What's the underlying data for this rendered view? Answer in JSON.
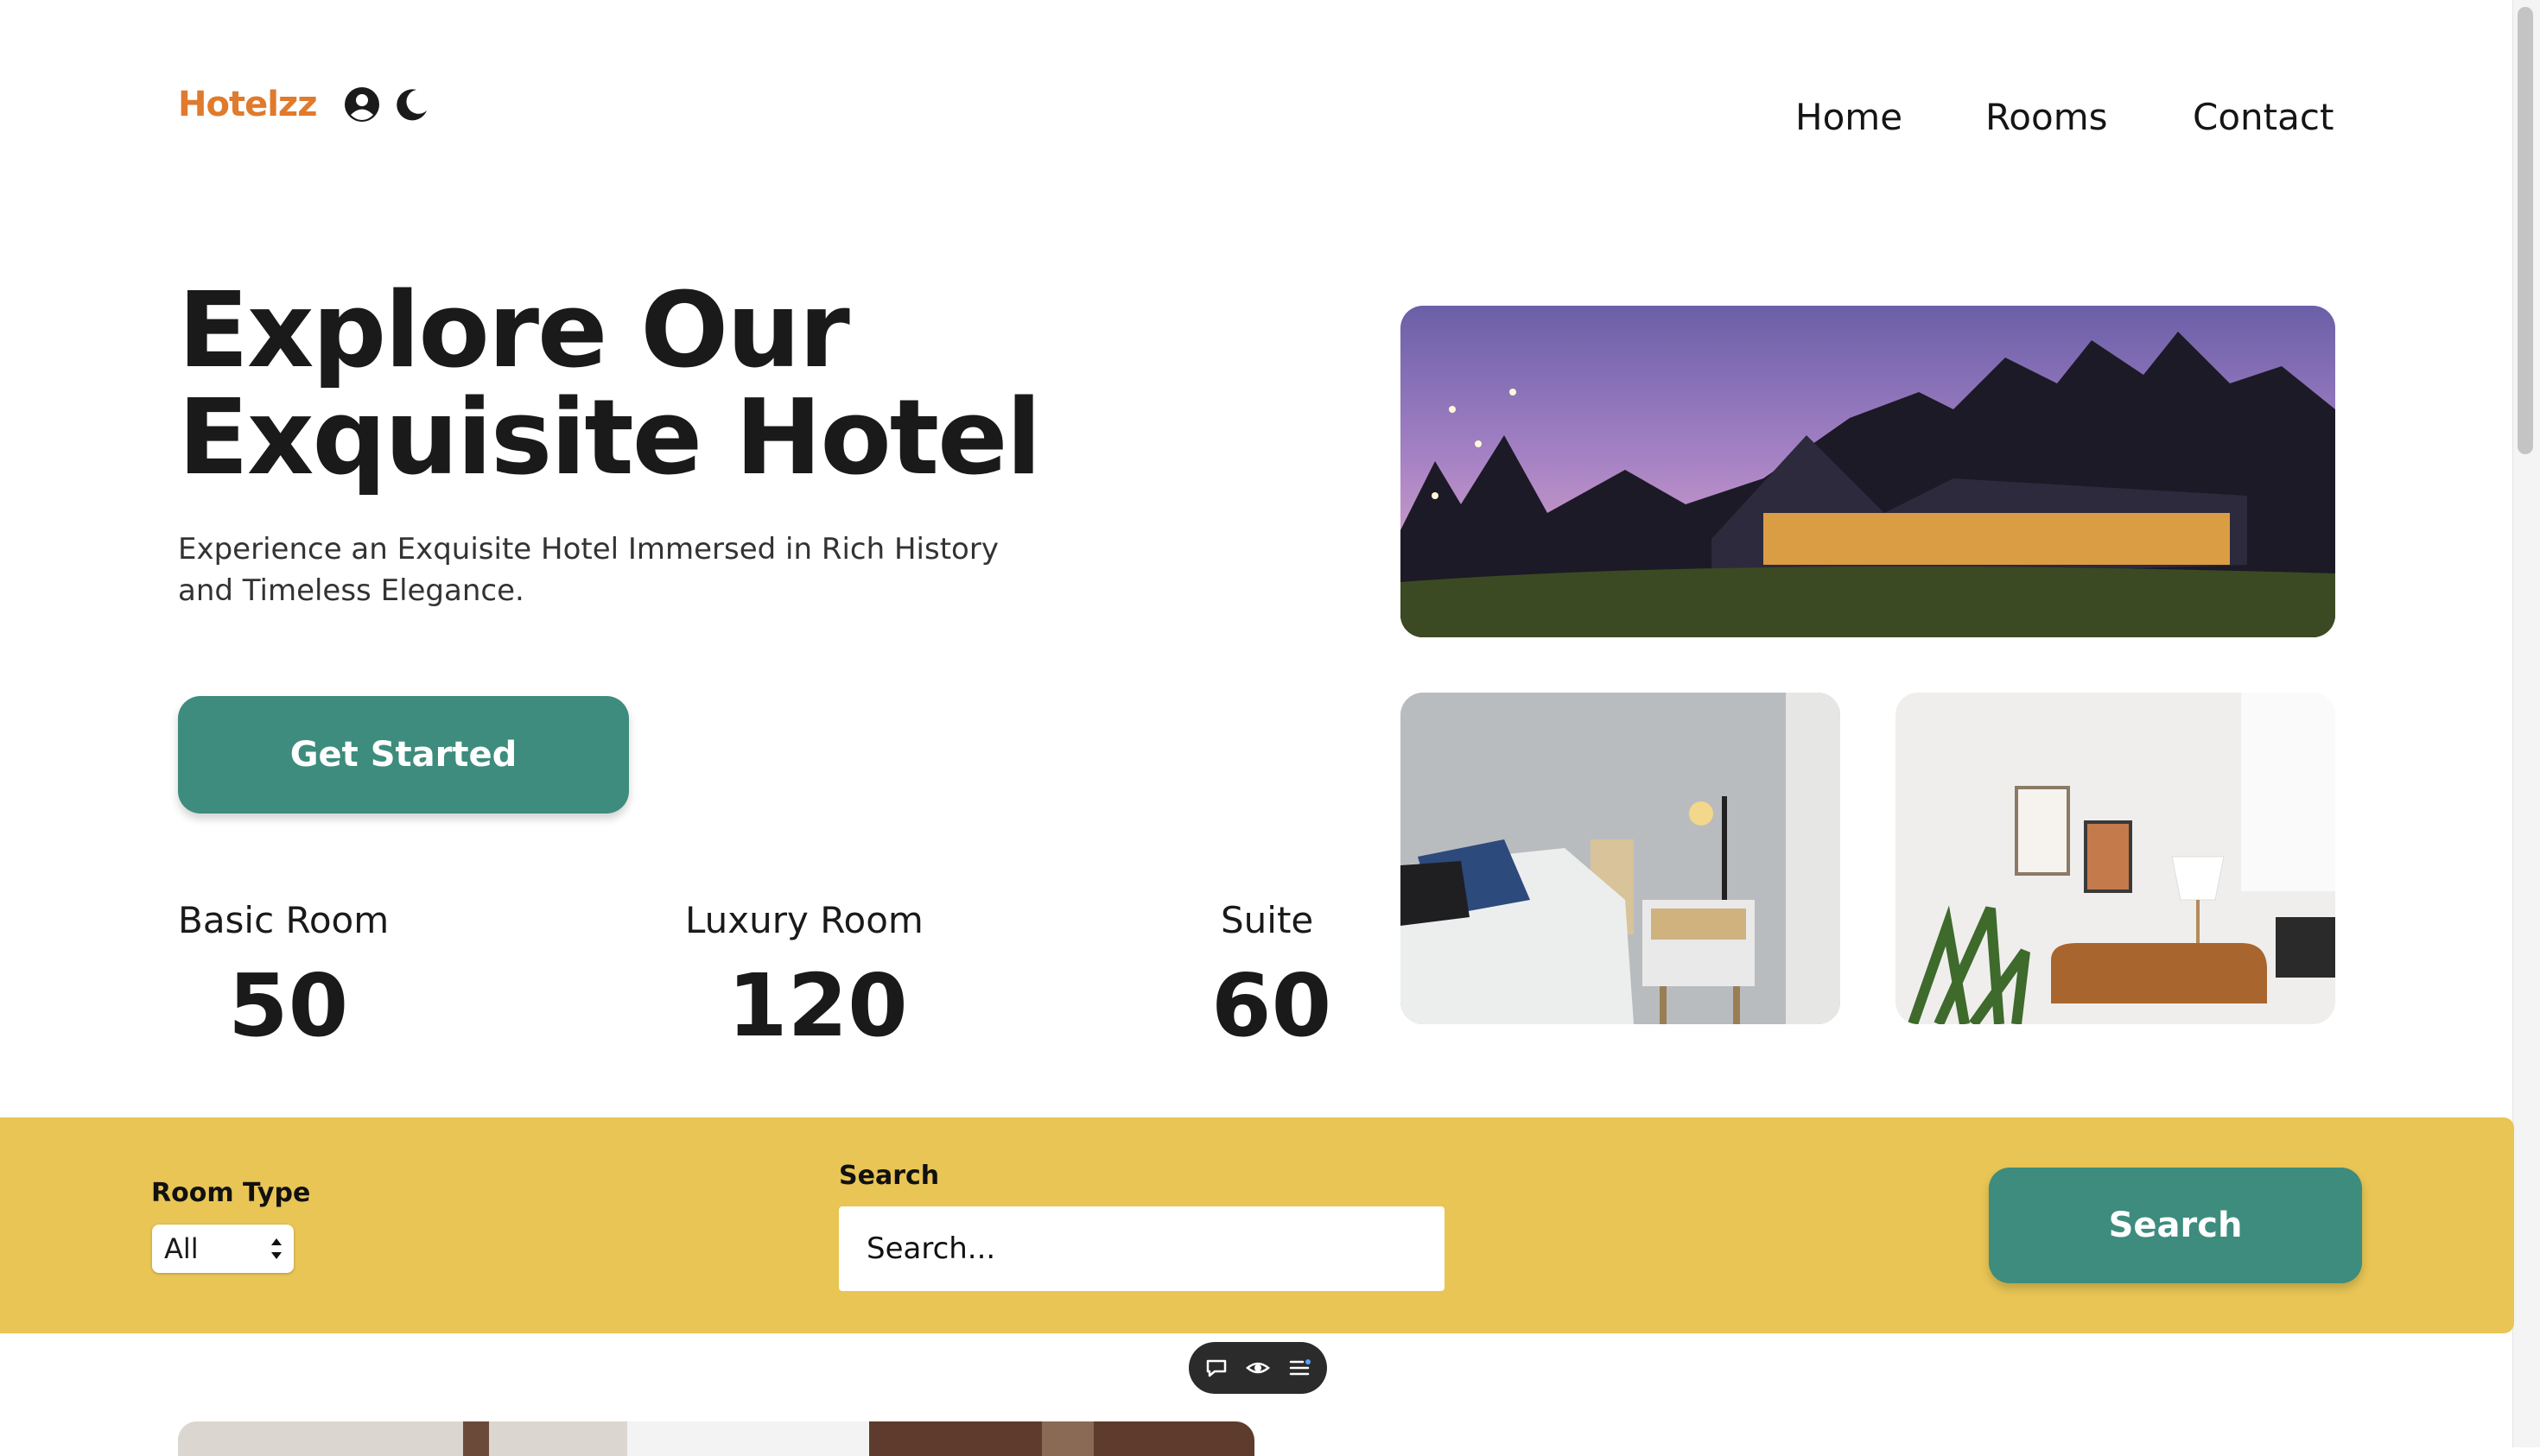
{
  "header": {
    "logo": "Hotelzz",
    "nav": [
      {
        "label": "Home"
      },
      {
        "label": "Rooms"
      },
      {
        "label": "Contact"
      }
    ],
    "icons": [
      "user-circle-icon",
      "moon-icon"
    ]
  },
  "hero": {
    "title": "Explore Our Exquisite Hotel",
    "subtitle": "Experience an Exquisite Hotel Immersed in Rich History and Timeless Elegance.",
    "cta_label": "Get Started"
  },
  "stats": [
    {
      "label": "Basic Room",
      "value": "50"
    },
    {
      "label": "Luxury Room",
      "value": "120"
    },
    {
      "label": "Suite",
      "value": "60"
    }
  ],
  "images": [
    "hotel-exterior-photo",
    "bedroom-photo",
    "living-room-photo"
  ],
  "search_bar": {
    "room_type_label": "Room Type",
    "room_type_selected": "All",
    "search_label": "Search",
    "search_placeholder": "Search...",
    "search_button": "Search"
  },
  "colors": {
    "accent": "#3d8c7d",
    "logo": "#e07a2c",
    "band": "#e8c554"
  },
  "floating_toolbar": [
    "comment-icon",
    "eye-icon",
    "list-icon"
  ]
}
